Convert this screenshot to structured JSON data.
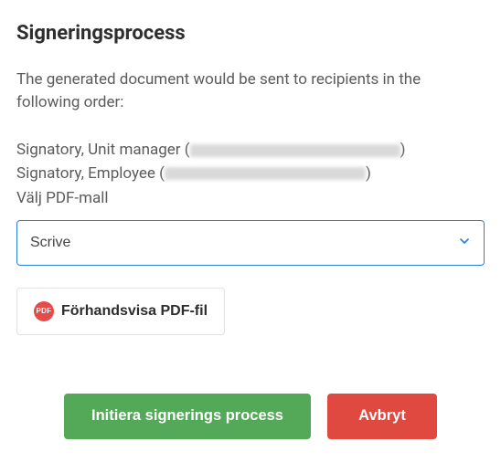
{
  "title": "Signeringsprocess",
  "intro": "The generated document would be sent to recipients in the following order:",
  "recipients": [
    {
      "prefix": "Signatory, Unit manager (",
      "suffix": ")"
    },
    {
      "prefix": "Signatory, Employee (",
      "suffix": ")"
    }
  ],
  "select": {
    "label": "Välj PDF-mall",
    "value": "Scrive"
  },
  "preview": {
    "badge": "PDF",
    "label": "Förhandsvisa PDF-fil"
  },
  "actions": {
    "initiate": "Initiera signerings process",
    "cancel": "Avbryt"
  }
}
